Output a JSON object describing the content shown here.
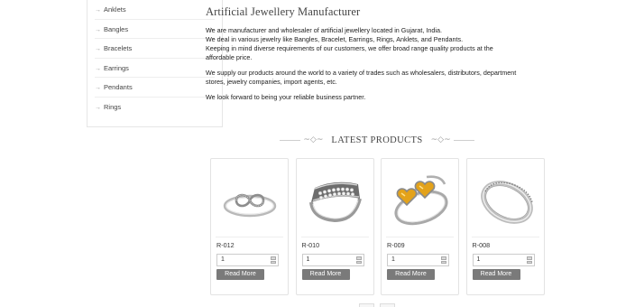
{
  "sidebar": {
    "items": [
      {
        "label": "Anklets",
        "expand": ""
      },
      {
        "label": "Bangles",
        "expand": "+"
      },
      {
        "label": "Bracelets",
        "expand": ""
      },
      {
        "label": "Earrings",
        "expand": ""
      },
      {
        "label": "Pendants",
        "expand": ""
      },
      {
        "label": "Rings",
        "expand": ""
      }
    ],
    "arrow": "→"
  },
  "intro": {
    "title": "Artificial Jewellery Manufacturer",
    "p1_l1": "We are manufacturer and wholesaler of artificial jewellery located in Gujarat, India.",
    "p1_l2": "We deal in various jewelry like Bangles, Bracelet, Earrings, Rings, Anklets, and Pendants.",
    "p1_l3": "Keeping in mind diverse requirements of our customers, we offer broad range quality products at the",
    "p1_l4": "affordable price.",
    "p2_l1": "We supply our products around the world to a variety of trades such as wholesalers, distributors, department",
    "p2_l2": "stores, jewelry companies, import agents, etc.",
    "p3": "We look forward to being your reliable business partner."
  },
  "latest": {
    "title": "LATEST PRODUCTS",
    "ornament_left": "~◇~",
    "ornament_right": "~◇~"
  },
  "products": [
    {
      "code": "R-012",
      "qty": "1",
      "button": "Read More",
      "image": "infinity-ring"
    },
    {
      "code": "R-010",
      "qty": "1",
      "button": "Read More",
      "image": "band-ring"
    },
    {
      "code": "R-009",
      "qty": "1",
      "button": "Read More",
      "image": "hearts-ring"
    },
    {
      "code": "R-008",
      "qty": "1",
      "button": "Read More",
      "image": "eternity-ring"
    }
  ],
  "colors": {
    "button_bg": "#7a7a7a",
    "citrine": "#e3a21a"
  }
}
